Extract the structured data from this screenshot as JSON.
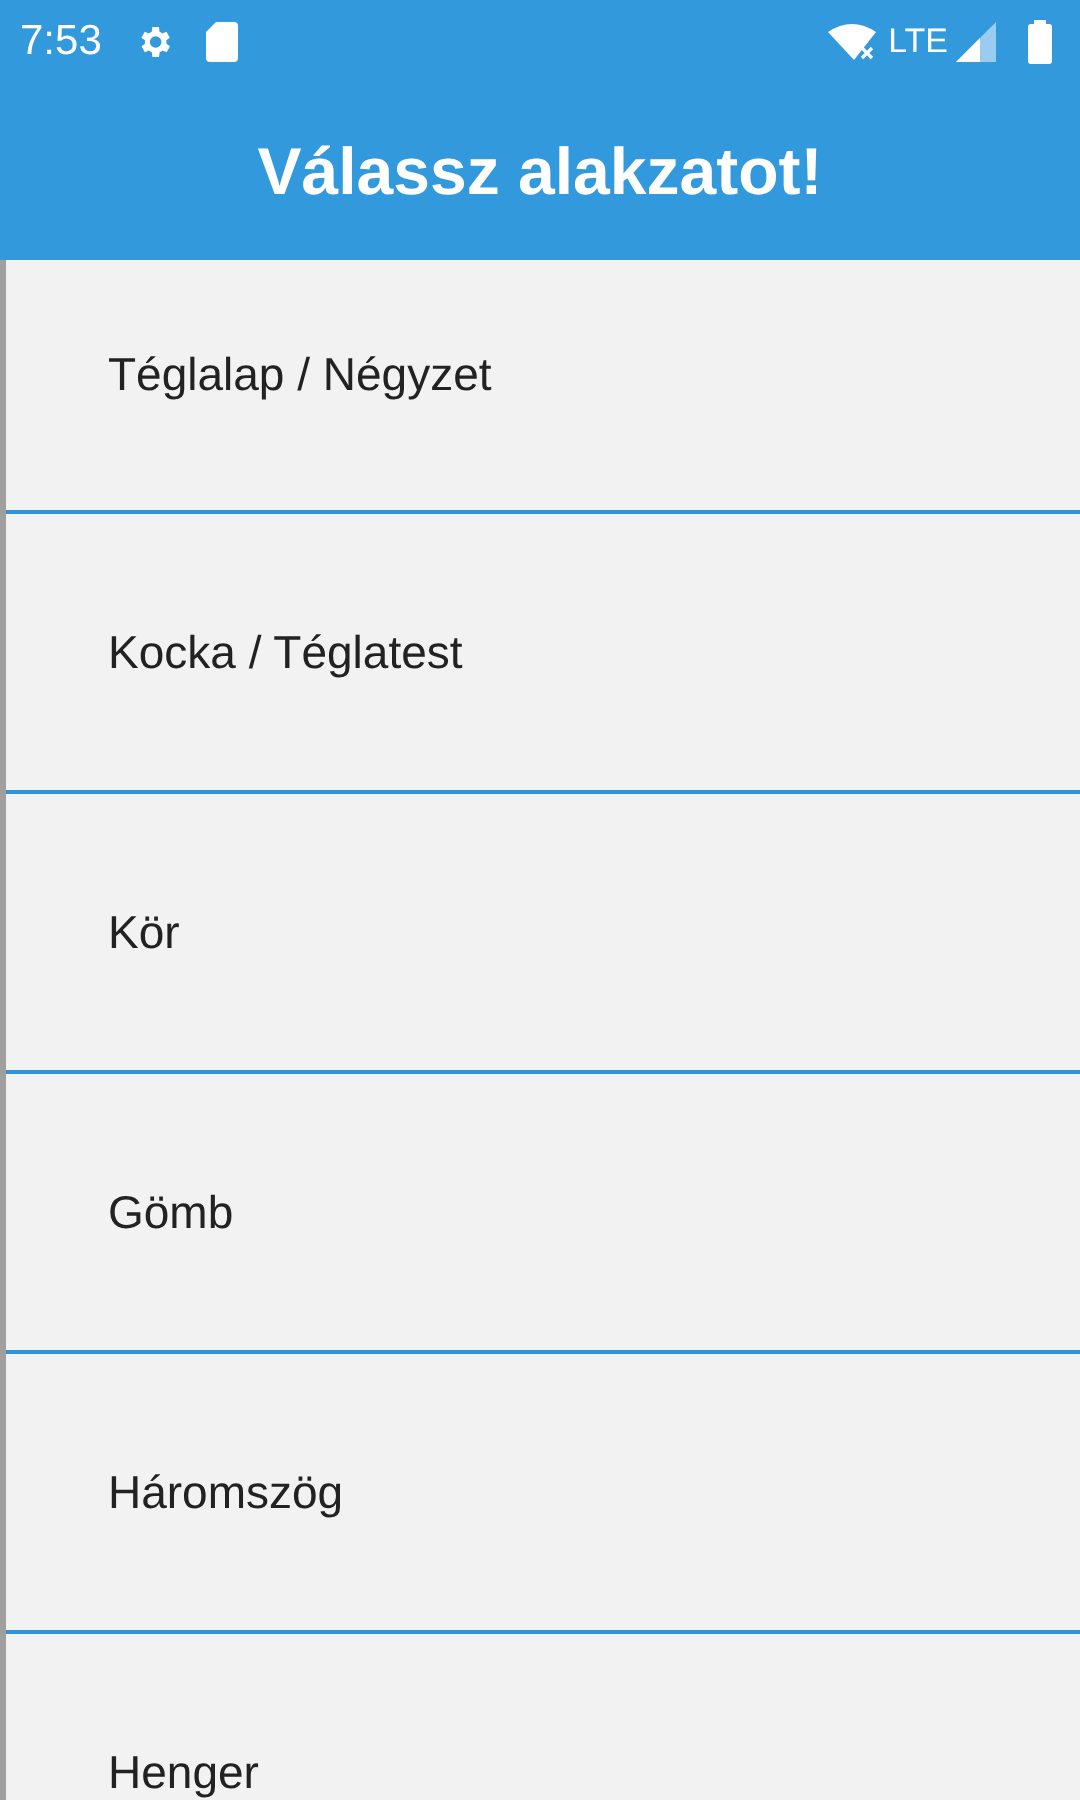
{
  "status_bar": {
    "time": "7:53",
    "network": "LTE"
  },
  "app_bar": {
    "title": "Válassz alakzatot!"
  },
  "shapes": [
    {
      "label": "Téglalap / Négyzet"
    },
    {
      "label": "Kocka / Téglatest"
    },
    {
      "label": "Kör"
    },
    {
      "label": "Gömb"
    },
    {
      "label": "Háromszög"
    },
    {
      "label": "Henger"
    }
  ]
}
